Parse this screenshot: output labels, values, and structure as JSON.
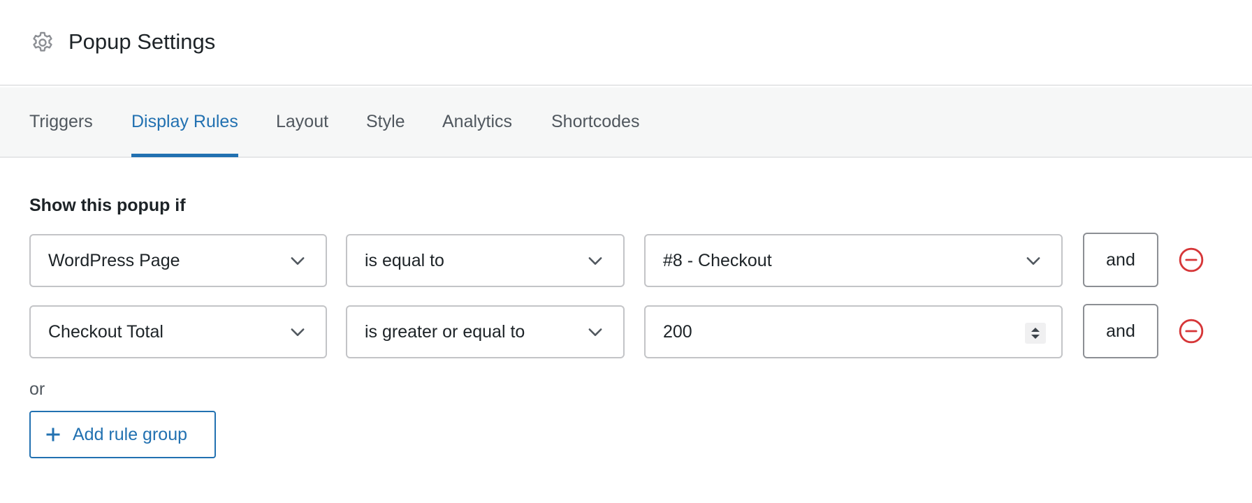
{
  "header": {
    "title": "Popup Settings",
    "icon": "gear-icon"
  },
  "tabs": [
    {
      "label": "Triggers",
      "active": false
    },
    {
      "label": "Display Rules",
      "active": true
    },
    {
      "label": "Layout",
      "active": false
    },
    {
      "label": "Style",
      "active": false
    },
    {
      "label": "Analytics",
      "active": false
    },
    {
      "label": "Shortcodes",
      "active": false
    }
  ],
  "rules": {
    "heading": "Show this popup if",
    "rows": [
      {
        "field": "WordPress Page",
        "operator": "is equal to",
        "value": "#8 - Checkout",
        "connector": "and"
      },
      {
        "field": "Checkout Total",
        "operator": "is greater or equal to",
        "value": "200",
        "connector": "and"
      }
    ],
    "or_label": "or",
    "add_group_label": "Add rule group"
  },
  "colors": {
    "accent": "#2271b1",
    "remove": "#d63638",
    "border": "#c3c4c7",
    "tab_bar_bg": "#f6f7f7"
  }
}
